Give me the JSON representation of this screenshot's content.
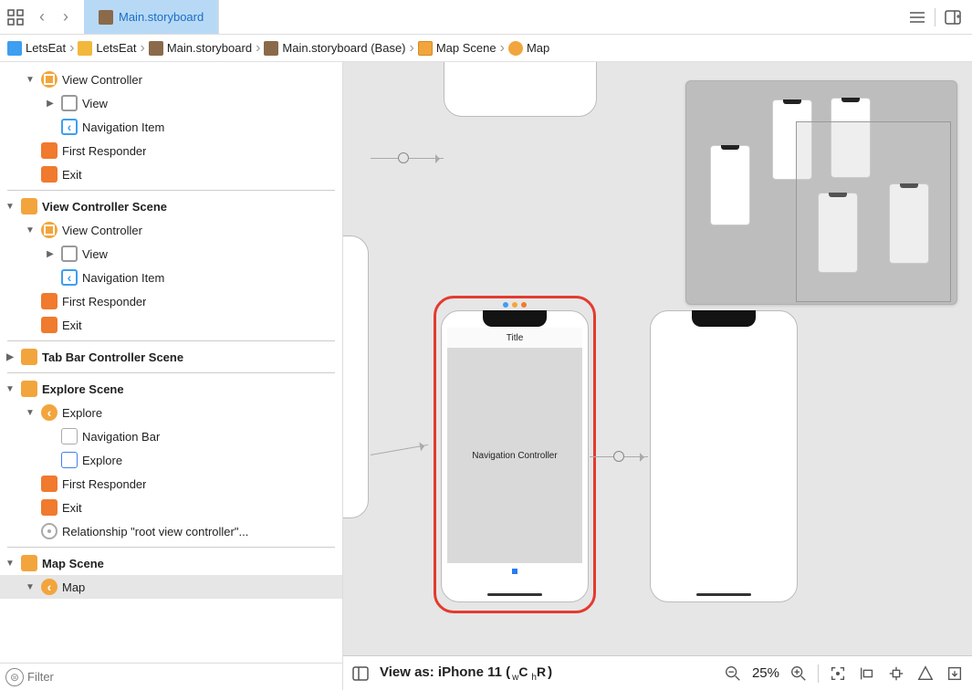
{
  "tab": {
    "title": "Main.storyboard"
  },
  "breadcrumb": [
    {
      "icon": "app",
      "label": "LetsEat"
    },
    {
      "icon": "folder",
      "label": "LetsEat"
    },
    {
      "icon": "sb",
      "label": "Main.storyboard"
    },
    {
      "icon": "sb",
      "label": "Main.storyboard (Base)"
    },
    {
      "icon": "scene",
      "label": "Map Scene"
    },
    {
      "icon": "map",
      "label": "Map"
    }
  ],
  "outline": {
    "sections": [
      {
        "rows": [
          {
            "indent": 1,
            "disc": "open",
            "icon": "vc",
            "label": "View Controller"
          },
          {
            "indent": 2,
            "disc": "closed",
            "icon": "view",
            "label": "View"
          },
          {
            "indent": 2,
            "disc": "none",
            "icon": "navitem",
            "label": "Navigation Item"
          },
          {
            "indent": 1,
            "disc": "none",
            "icon": "responder",
            "label": "First Responder"
          },
          {
            "indent": 1,
            "disc": "none",
            "icon": "exit",
            "label": "Exit"
          }
        ]
      },
      {
        "header": {
          "indent": 0,
          "disc": "open",
          "icon": "scene",
          "label": "View Controller Scene",
          "bold": true
        },
        "rows": [
          {
            "indent": 1,
            "disc": "open",
            "icon": "vc",
            "label": "View Controller"
          },
          {
            "indent": 2,
            "disc": "closed",
            "icon": "view",
            "label": "View"
          },
          {
            "indent": 2,
            "disc": "none",
            "icon": "navitem",
            "label": "Navigation Item"
          },
          {
            "indent": 1,
            "disc": "none",
            "icon": "responder",
            "label": "First Responder"
          },
          {
            "indent": 1,
            "disc": "none",
            "icon": "exit",
            "label": "Exit"
          }
        ]
      },
      {
        "header": {
          "indent": 0,
          "disc": "closed",
          "icon": "scene",
          "label": "Tab Bar Controller Scene",
          "bold": true
        },
        "rows": []
      },
      {
        "header": {
          "indent": 0,
          "disc": "open",
          "icon": "scene",
          "label": "Explore Scene",
          "bold": true
        },
        "rows": [
          {
            "indent": 1,
            "disc": "open",
            "icon": "map",
            "label": "Explore"
          },
          {
            "indent": 2,
            "disc": "none",
            "icon": "navbar",
            "label": "Navigation Bar"
          },
          {
            "indent": 2,
            "disc": "none",
            "icon": "star",
            "label": "Explore"
          },
          {
            "indent": 1,
            "disc": "none",
            "icon": "responder",
            "label": "First Responder"
          },
          {
            "indent": 1,
            "disc": "none",
            "icon": "exit",
            "label": "Exit"
          },
          {
            "indent": 1,
            "disc": "none",
            "icon": "rel",
            "label": "Relationship \"root view controller\"..."
          }
        ]
      },
      {
        "header": {
          "indent": 0,
          "disc": "open",
          "icon": "scene",
          "label": "Map Scene",
          "bold": true
        },
        "rows": [
          {
            "indent": 1,
            "disc": "open",
            "icon": "map",
            "label": "Map",
            "selected": true
          }
        ]
      }
    ],
    "filterPlaceholder": "Filter"
  },
  "canvas": {
    "navTitle": "Title",
    "navBody": "Navigation Controller"
  },
  "bottombar": {
    "device": "View as: iPhone 11 (",
    "traits_wC": "C",
    "traits_hR": "R",
    "close": ")",
    "zoom": "25%"
  }
}
